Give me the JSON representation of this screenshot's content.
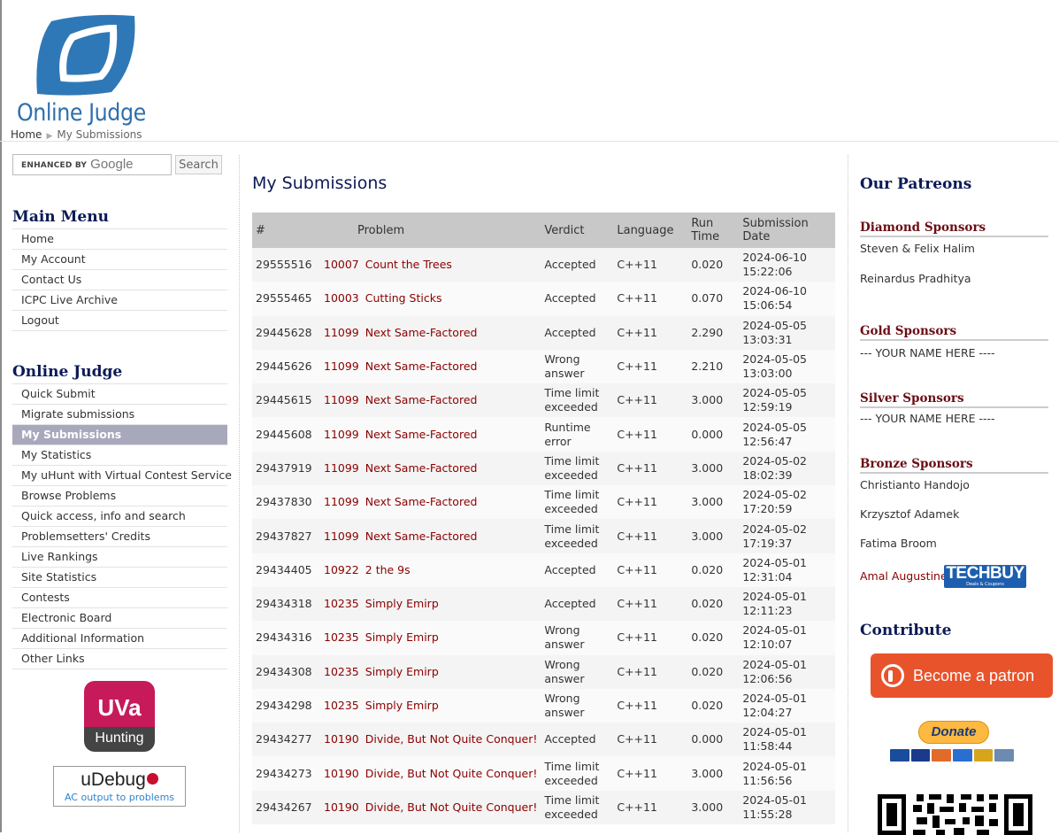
{
  "header": {
    "logo_text": "Online Judge",
    "breadcrumb": {
      "home": "Home",
      "current": "My Submissions"
    }
  },
  "search": {
    "enhanced_label": "ENHANCED BY",
    "google_label": "Google",
    "button_label": "Search"
  },
  "main_menu": {
    "title": "Main Menu",
    "items": [
      "Home",
      "My Account",
      "Contact Us",
      "ICPC Live Archive",
      "Logout"
    ]
  },
  "online_judge_menu": {
    "title": "Online Judge",
    "items": [
      "Quick Submit",
      "Migrate submissions",
      "My Submissions",
      "My Statistics",
      "My uHunt with Virtual Contest Service",
      "Browse Problems",
      "Quick access, info and search",
      "Problemsetters' Credits",
      "Live Rankings",
      "Site Statistics",
      "Contests",
      "Electronic Board",
      "Additional Information",
      "Other Links"
    ],
    "active": "My Submissions"
  },
  "badges": {
    "uva_top": "UVa",
    "uva_bottom": "Hunting",
    "udebug_name": "uDebug",
    "udebug_tagline": "AC output to problems"
  },
  "content": {
    "title": "My Submissions",
    "columns": [
      "#",
      "Problem",
      "Verdict",
      "Language",
      "Run Time",
      "Submission Date"
    ],
    "rows": [
      {
        "id": "29555516",
        "pid": "10007",
        "pname": "Count the Trees",
        "verdict": "Accepted",
        "lang": "C++11",
        "time": "0.020",
        "date": "2024-06-10",
        "clock": "15:22:06"
      },
      {
        "id": "29555465",
        "pid": "10003",
        "pname": "Cutting Sticks",
        "verdict": "Accepted",
        "lang": "C++11",
        "time": "0.070",
        "date": "2024-06-10",
        "clock": "15:06:54"
      },
      {
        "id": "29445628",
        "pid": "11099",
        "pname": "Next Same-Factored",
        "verdict": "Accepted",
        "lang": "C++11",
        "time": "2.290",
        "date": "2024-05-05",
        "clock": "13:03:31"
      },
      {
        "id": "29445626",
        "pid": "11099",
        "pname": "Next Same-Factored",
        "verdict": "Wrong answer",
        "lang": "C++11",
        "time": "2.210",
        "date": "2024-05-05",
        "clock": "13:03:00"
      },
      {
        "id": "29445615",
        "pid": "11099",
        "pname": "Next Same-Factored",
        "verdict": "Time limit exceeded",
        "lang": "C++11",
        "time": "3.000",
        "date": "2024-05-05",
        "clock": "12:59:19"
      },
      {
        "id": "29445608",
        "pid": "11099",
        "pname": "Next Same-Factored",
        "verdict": "Runtime error",
        "lang": "C++11",
        "time": "0.000",
        "date": "2024-05-05",
        "clock": "12:56:47"
      },
      {
        "id": "29437919",
        "pid": "11099",
        "pname": "Next Same-Factored",
        "verdict": "Time limit exceeded",
        "lang": "C++11",
        "time": "3.000",
        "date": "2024-05-02",
        "clock": "18:02:39"
      },
      {
        "id": "29437830",
        "pid": "11099",
        "pname": "Next Same-Factored",
        "verdict": "Time limit exceeded",
        "lang": "C++11",
        "time": "3.000",
        "date": "2024-05-02",
        "clock": "17:20:59"
      },
      {
        "id": "29437827",
        "pid": "11099",
        "pname": "Next Same-Factored",
        "verdict": "Time limit exceeded",
        "lang": "C++11",
        "time": "3.000",
        "date": "2024-05-02",
        "clock": "17:19:37"
      },
      {
        "id": "29434405",
        "pid": "10922",
        "pname": "2 the 9s",
        "verdict": "Accepted",
        "lang": "C++11",
        "time": "0.020",
        "date": "2024-05-01",
        "clock": "12:31:04"
      },
      {
        "id": "29434318",
        "pid": "10235",
        "pname": "Simply Emirp",
        "verdict": "Accepted",
        "lang": "C++11",
        "time": "0.020",
        "date": "2024-05-01",
        "clock": "12:11:23"
      },
      {
        "id": "29434316",
        "pid": "10235",
        "pname": "Simply Emirp",
        "verdict": "Wrong answer",
        "lang": "C++11",
        "time": "0.020",
        "date": "2024-05-01",
        "clock": "12:10:07"
      },
      {
        "id": "29434308",
        "pid": "10235",
        "pname": "Simply Emirp",
        "verdict": "Wrong answer",
        "lang": "C++11",
        "time": "0.020",
        "date": "2024-05-01",
        "clock": "12:06:56"
      },
      {
        "id": "29434298",
        "pid": "10235",
        "pname": "Simply Emirp",
        "verdict": "Wrong answer",
        "lang": "C++11",
        "time": "0.020",
        "date": "2024-05-01",
        "clock": "12:04:27"
      },
      {
        "id": "29434277",
        "pid": "10190",
        "pname": "Divide, But Not Quite Conquer!",
        "verdict": "Accepted",
        "lang": "C++11",
        "time": "0.000",
        "date": "2024-05-01",
        "clock": "11:58:44"
      },
      {
        "id": "29434273",
        "pid": "10190",
        "pname": "Divide, But Not Quite Conquer!",
        "verdict": "Time limit exceeded",
        "lang": "C++11",
        "time": "3.000",
        "date": "2024-05-01",
        "clock": "11:56:56"
      },
      {
        "id": "29434267",
        "pid": "10190",
        "pname": "Divide, But Not Quite Conquer!",
        "verdict": "Time limit exceeded",
        "lang": "C++11",
        "time": "3.000",
        "date": "2024-05-01",
        "clock": "11:55:28"
      }
    ]
  },
  "patreons": {
    "title": "Our Patreons",
    "diamond": {
      "title": "Diamond Sponsors",
      "names": [
        "Steven & Felix Halim",
        "Reinardus Pradhitya"
      ]
    },
    "gold": {
      "title": "Gold Sponsors",
      "names": [
        "--- YOUR NAME HERE ----"
      ]
    },
    "silver": {
      "title": "Silver Sponsors",
      "names": [
        "--- YOUR NAME HERE ----"
      ]
    },
    "bronze": {
      "title": "Bronze Sponsors",
      "names": [
        "Christianto Handojo",
        "Krzysztof Adamek",
        "Fatima Broom",
        "Amal Augustine"
      ]
    },
    "techbuy_label": "TECHBUY",
    "techbuy_sub": "Deals & Coupons"
  },
  "contribute": {
    "title": "Contribute",
    "patron_button": "Become a patron",
    "donate_button": "Donate"
  },
  "colors": {
    "accent": "#0b1a56",
    "link_red": "#8b0000",
    "active_menu": "#a8a8bd",
    "table_header": "#c8c8c8",
    "patron_orange": "#e8532b",
    "logo_blue": "#2f6fad"
  }
}
